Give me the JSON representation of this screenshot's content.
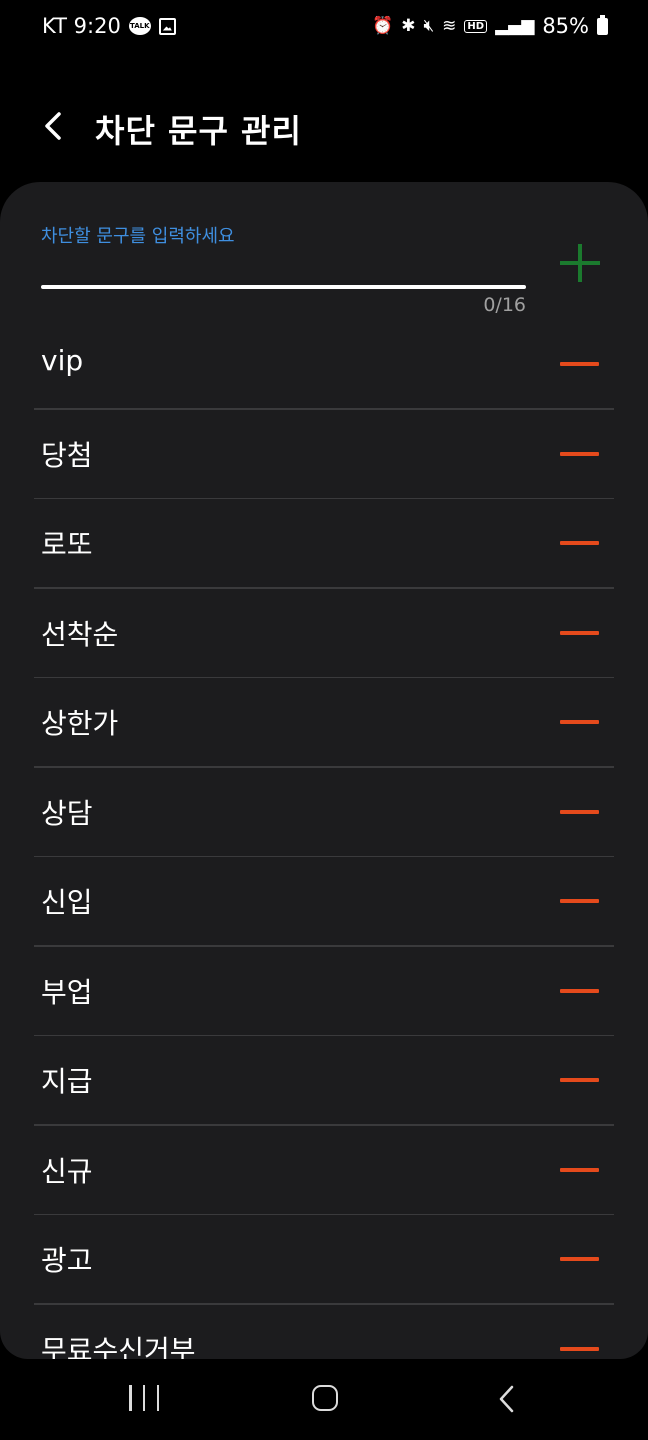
{
  "status_bar": {
    "carrier_time": "KT 9:20",
    "talk_icon_text": "TALK",
    "battery": "85%"
  },
  "app_bar": {
    "title": "차단 문구 관리"
  },
  "input": {
    "label": "차단할 문구를 입력하세요",
    "value": "",
    "counter": "0/16"
  },
  "phrases": [
    "vip",
    "당첨",
    "로또",
    "선착순",
    "상한가",
    "상담",
    "신입",
    "부업",
    "지급",
    "신규",
    "광고",
    "무료수신거부"
  ],
  "colors": {
    "accent_blue": "#3f8fe0",
    "add_green": "#1b7a2e",
    "remove_red": "#e54a1c",
    "card_bg": "#1c1c1e"
  }
}
